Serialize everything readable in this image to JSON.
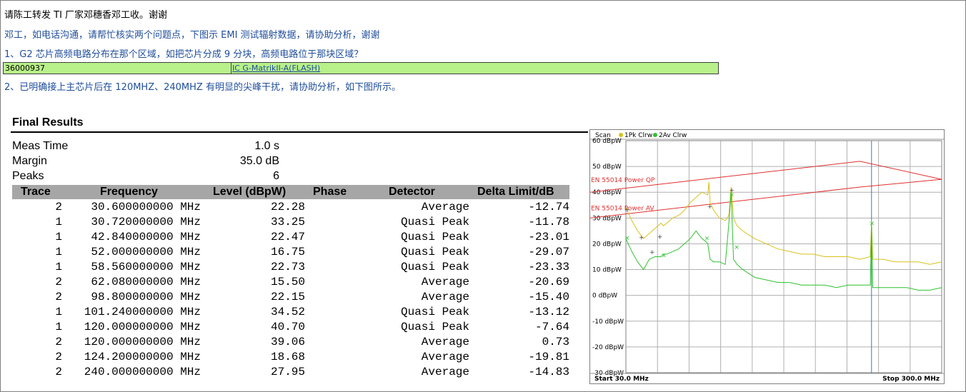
{
  "header": {
    "line1": "请陈工转发 TI 厂家邓穗香邓工收。谢谢",
    "line2": "邓工，如电话沟通，请帮忙核实两个问题点，下图示 EMI 测试辐射数据，请协助分析，谢谢",
    "line3": "1、G2 芯片高频电路分布在那个区域，如把芯片分成 9 分块，高频电路位于那块区域？",
    "part_number": "36000937",
    "part_name": "IC G-MatrikII-A(FLASH)",
    "line5": "2、已明确接上主芯片后在 120MHZ、240MHZ 有明显的尖峰干扰，请协助分析，如下图所示。"
  },
  "results": {
    "title": "Final Results",
    "meas_time_label": "Meas Time",
    "meas_time_value": "1.0 s",
    "margin_label": "Margin",
    "margin_value": "35.0 dB",
    "peaks_label": "Peaks",
    "peaks_value": "6",
    "columns": [
      "Trace",
      "Frequency",
      "Level (dBpW)",
      "Phase",
      "Detector",
      "Delta Limit/dB"
    ],
    "rows": [
      [
        "2",
        "30.600000000 MHz",
        "22.28",
        "Average",
        "-12.74"
      ],
      [
        "1",
        "30.720000000 MHz",
        "33.25",
        "Quasi Peak",
        "-11.78"
      ],
      [
        "1",
        "42.840000000 MHz",
        "22.47",
        "Quasi Peak",
        "-23.01"
      ],
      [
        "1",
        "52.000000000 MHz",
        "16.75",
        "Quasi Peak",
        "-29.07"
      ],
      [
        "1",
        "58.560000000 MHz",
        "22.73",
        "Quasi Peak",
        "-23.33"
      ],
      [
        "2",
        "62.080000000 MHz",
        "15.50",
        "Average",
        "-20.69"
      ],
      [
        "2",
        "98.800000000 MHz",
        "22.15",
        "Average",
        "-15.40"
      ],
      [
        "1",
        "101.240000000 MHz",
        "34.52",
        "Quasi Peak",
        "-13.12"
      ],
      [
        "1",
        "120.000000000 MHz",
        "40.70",
        "Quasi Peak",
        "-7.64"
      ],
      [
        "2",
        "120.000000000 MHz",
        "39.06",
        "Average",
        "0.73"
      ],
      [
        "2",
        "124.200000000 MHz",
        "18.68",
        "Average",
        "-19.81"
      ],
      [
        "2",
        "240.000000000 MHz",
        "27.95",
        "Average",
        "-14.83"
      ]
    ]
  },
  "spectrum": {
    "legend_scan": "Scan",
    "legend_trace1": "1Pk Clrw",
    "legend_trace2": "2Av Clrw",
    "start_label": "Start 30.0 MHz",
    "stop_label": "Stop 300.0 MHz",
    "limit_qp_label": "EN 55014 Power QP",
    "limit_av_label": "EN 55014 Power AV",
    "y_ticks": [
      "60 dBpW",
      "50 dBpW",
      "40 dBpW",
      "30 dBpW",
      "20 dBpW",
      "10 dBpW",
      "0 dBpW",
      "-10 dBpW",
      "-20 dBpW",
      "-30 dBpW"
    ],
    "colors": {
      "peak": "#d9c21a",
      "average": "#2fc22f",
      "limit": "#e03030",
      "marker_line": "#3a7ab8"
    }
  },
  "chart_data": {
    "type": "line",
    "title": "",
    "xlabel": "",
    "ylabel": "",
    "xlim": [
      30,
      300
    ],
    "ylim": [
      -30,
      60
    ],
    "x_unit": "MHz",
    "y_unit": "dBpW",
    "series": [
      {
        "name": "1Pk Clrw",
        "x": [
          30,
          35,
          40,
          45,
          50,
          55,
          60,
          62,
          65,
          70,
          75,
          80,
          85,
          90,
          95,
          100,
          101,
          102,
          105,
          110,
          115,
          118,
          120,
          122,
          125,
          130,
          140,
          150,
          160,
          170,
          180,
          190,
          200,
          210,
          220,
          230,
          239,
          240,
          241,
          250,
          260,
          270,
          280,
          290,
          300
        ],
        "y": [
          34,
          29,
          25,
          22,
          24,
          26,
          28,
          27,
          28,
          30,
          31,
          33,
          36,
          38,
          40,
          39,
          44,
          36,
          33,
          30,
          29,
          31,
          42,
          30,
          27,
          25,
          22,
          20,
          18,
          17,
          16,
          16,
          15,
          15,
          15,
          14,
          15,
          29,
          14,
          14,
          13,
          13,
          13,
          12,
          13
        ]
      },
      {
        "name": "2Av Clrw",
        "x": [
          30,
          35,
          40,
          45,
          50,
          55,
          60,
          62,
          65,
          70,
          75,
          80,
          85,
          90,
          95,
          98,
          100,
          102,
          105,
          110,
          115,
          118,
          120,
          122,
          125,
          130,
          140,
          150,
          160,
          170,
          180,
          190,
          200,
          210,
          220,
          230,
          239,
          240,
          241,
          250,
          260,
          270,
          280,
          290,
          300
        ],
        "y": [
          22,
          17,
          13,
          10,
          14,
          15,
          15,
          16,
          16,
          17,
          18,
          20,
          22,
          25,
          22,
          21,
          20,
          14,
          13,
          13,
          12,
          28,
          40,
          14,
          12,
          10,
          7,
          6,
          5,
          5,
          4,
          4,
          4,
          3,
          4,
          4,
          4,
          28,
          3,
          3,
          3,
          3,
          2,
          2,
          3
        ]
      }
    ]
  }
}
